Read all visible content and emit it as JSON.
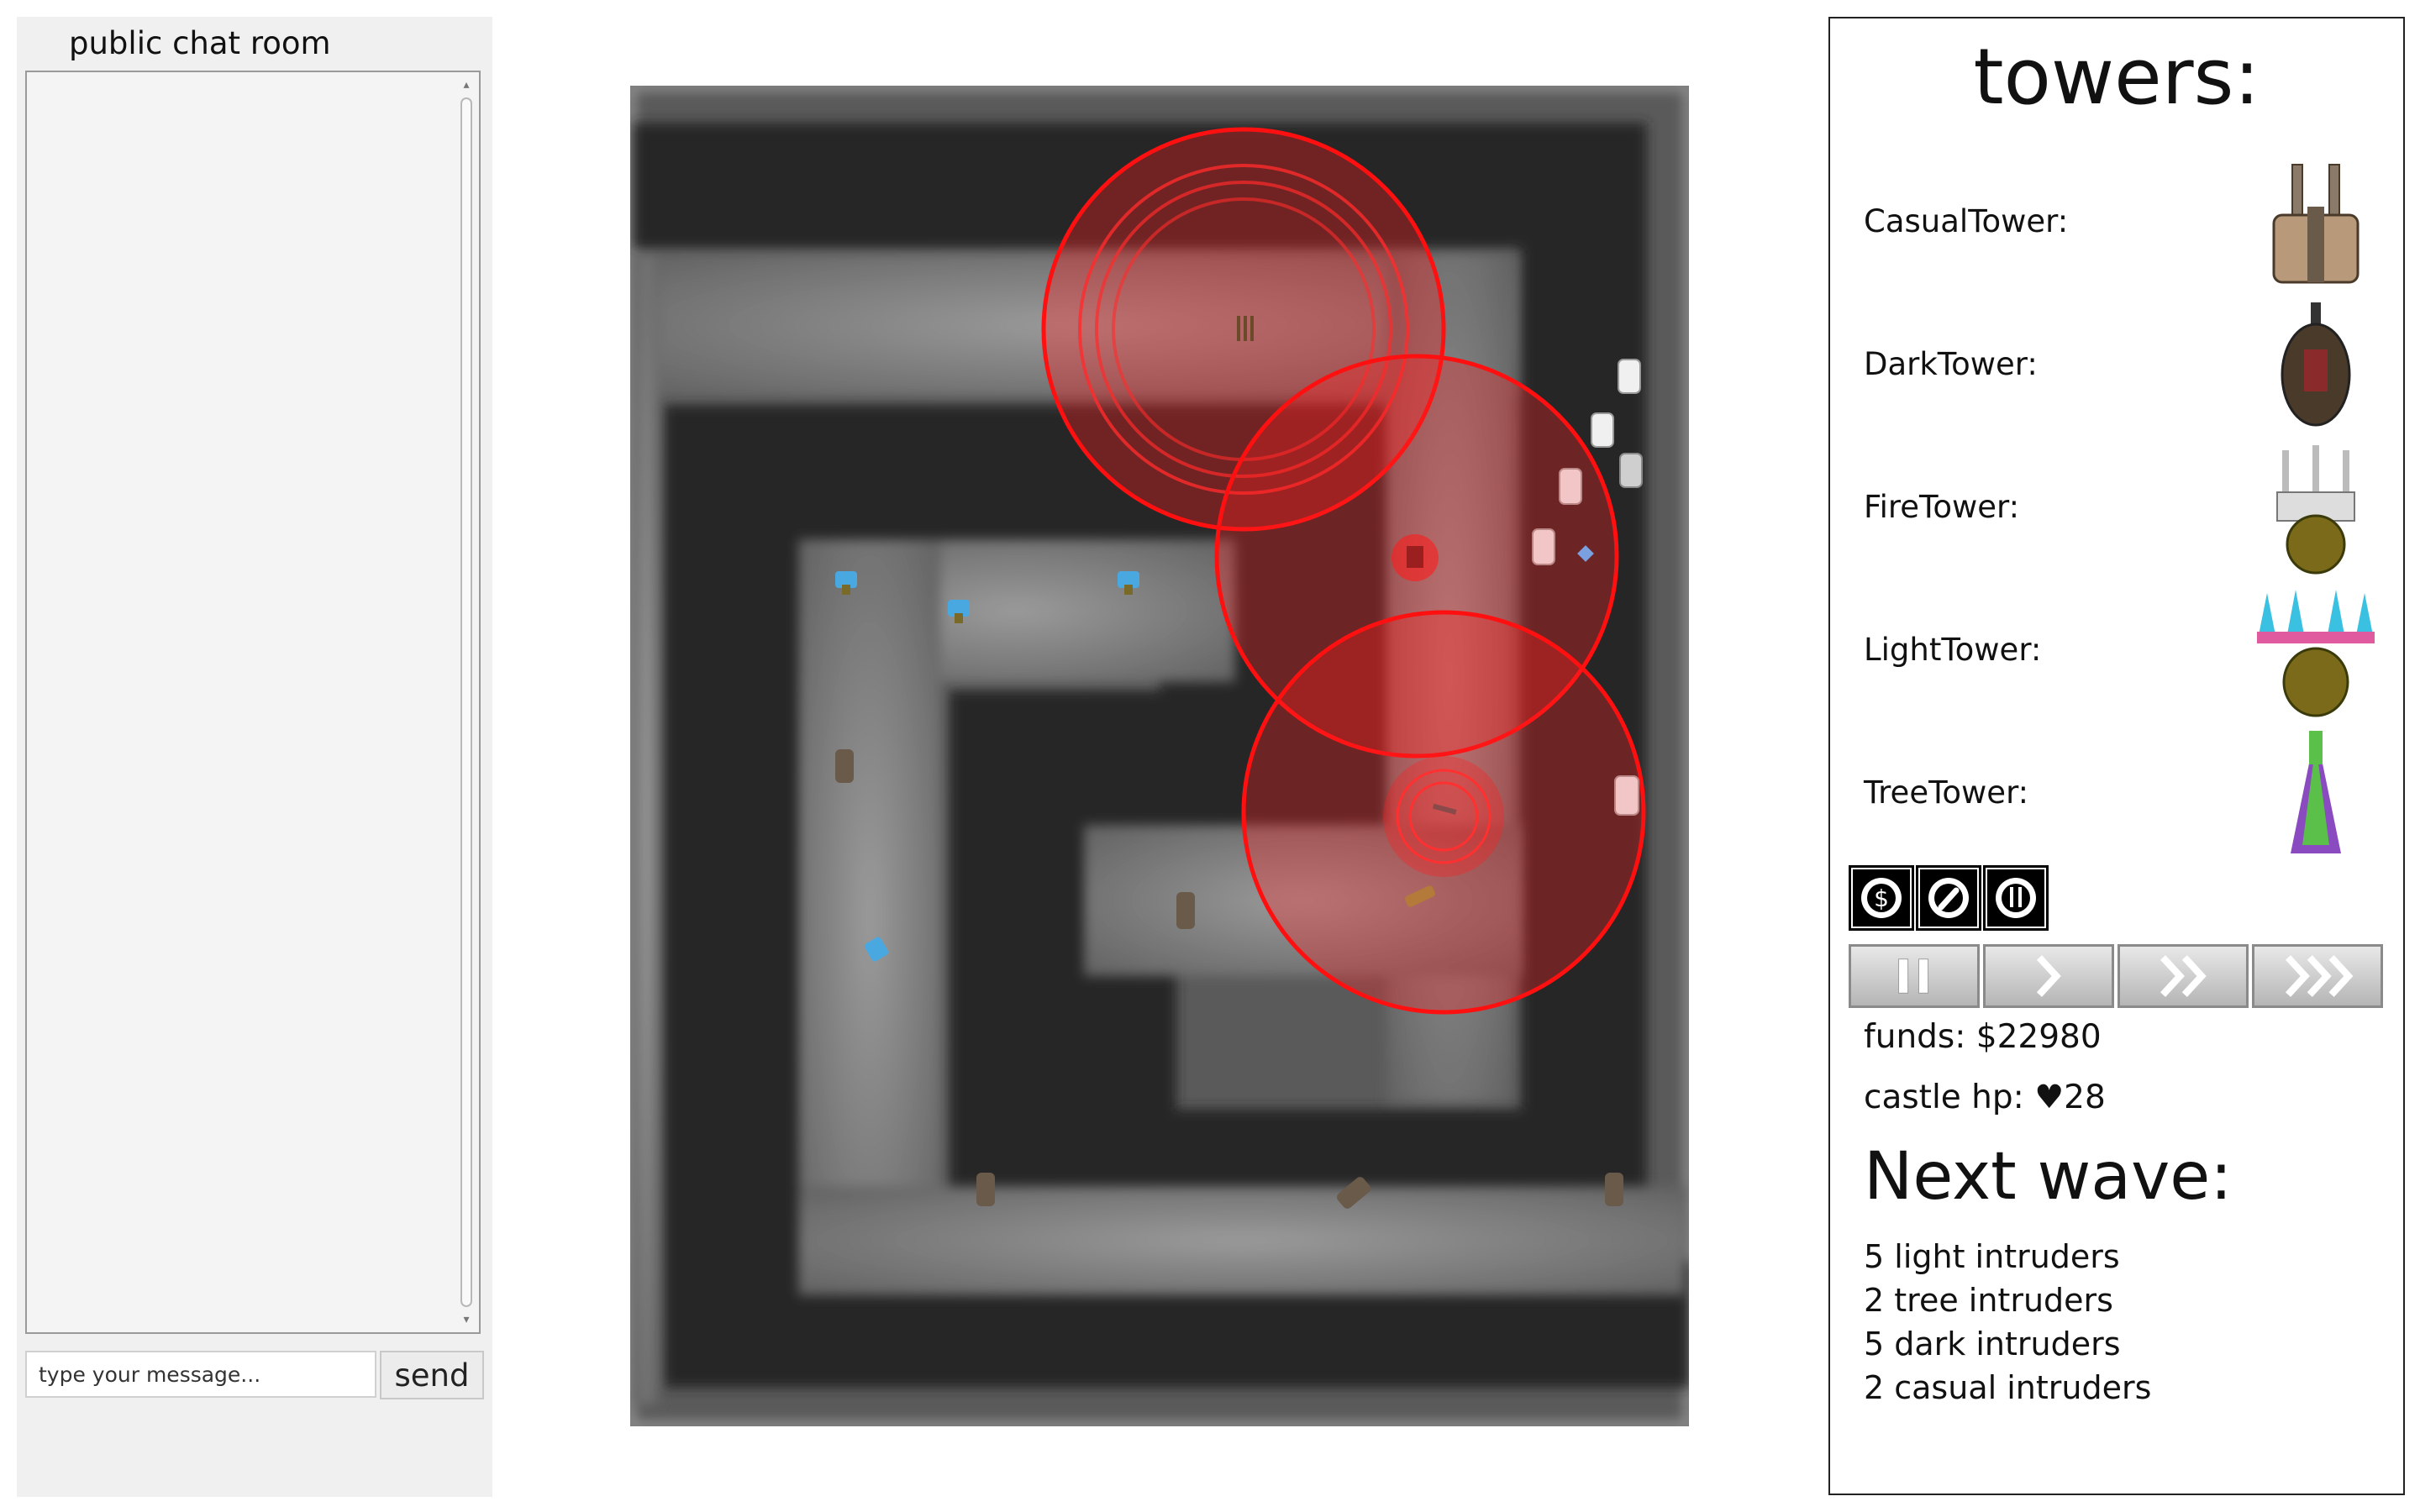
{
  "chat": {
    "title": "public chat room",
    "input_placeholder": "type your message...",
    "send_label": "send"
  },
  "panel": {
    "heading": "towers:",
    "towers": [
      {
        "label": "CasualTower:",
        "icon": "casual-tower-icon"
      },
      {
        "label": "DarkTower:",
        "icon": "dark-tower-icon"
      },
      {
        "label": "FireTower:",
        "icon": "fire-tower-icon"
      },
      {
        "label": "LightTower:",
        "icon": "light-tower-icon"
      },
      {
        "label": "TreeTower:",
        "icon": "tree-tower-icon"
      }
    ],
    "tools": [
      "sell-icon",
      "upgrade-icon",
      "tower-info-icon"
    ],
    "speed_controls": [
      "pause-icon",
      "speed-1x-icon",
      "speed-2x-icon",
      "speed-3x-icon"
    ],
    "funds_text": "funds: $22980",
    "hp_prefix": "castle hp: ",
    "hp_value": "28",
    "next_wave_heading": "Next wave:",
    "next_wave": [
      "5 light intruders",
      "2 tree intruders",
      "5 dark intruders",
      "2 casual intruders"
    ]
  },
  "colors": {
    "range_ring": "#ff0000",
    "path": "#7a7a7a",
    "wall": "#2a2a2a"
  }
}
